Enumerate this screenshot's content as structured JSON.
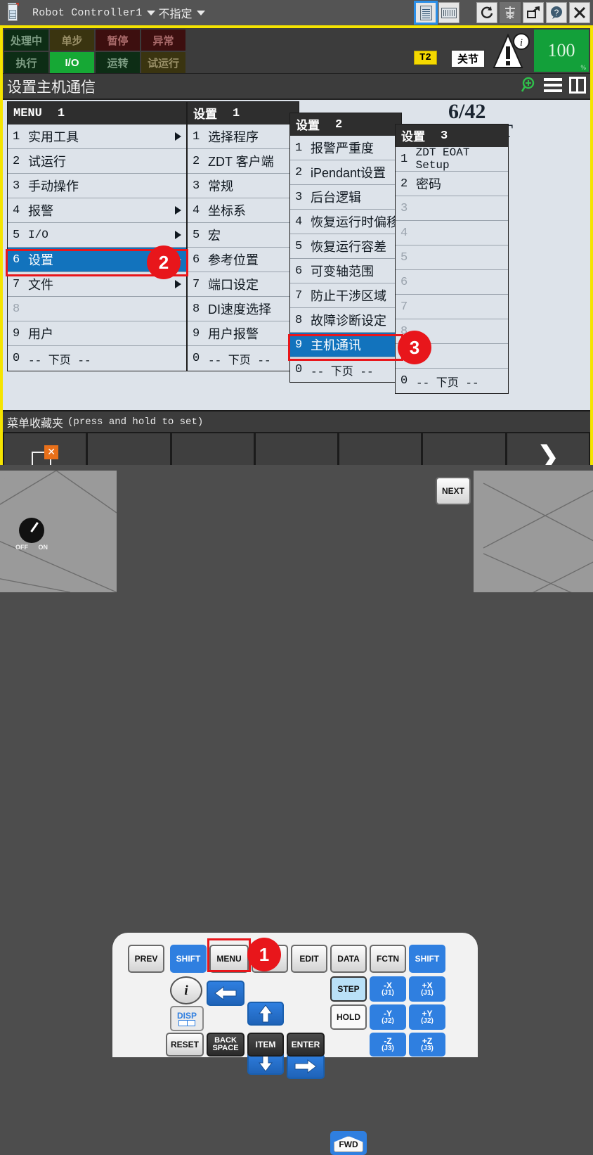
{
  "titlebar": {
    "app_icon": "pendant-icon",
    "title": "Robot Controller1",
    "subtitle": "不指定",
    "buttons": [
      {
        "name": "pendant-view-button",
        "icon": "pendant-icon",
        "selected": true
      },
      {
        "name": "keyboard-button",
        "icon": "keyboard-icon",
        "selected": false
      },
      {
        "name": "refresh-button",
        "icon": "refresh-icon",
        "selected": false
      },
      {
        "name": "robot-tree-button",
        "icon": "robot-tree-icon",
        "selected": false
      },
      {
        "name": "popout-button",
        "icon": "popout-icon",
        "selected": false
      },
      {
        "name": "help-button",
        "icon": "help-icon",
        "selected": false
      },
      {
        "name": "close-button",
        "icon": "close-icon",
        "selected": false
      }
    ]
  },
  "status": {
    "cells": [
      {
        "label": "处理中",
        "style": "dkgreen"
      },
      {
        "label": "单步",
        "style": "olive"
      },
      {
        "label": "暂停",
        "style": "dkred"
      },
      {
        "label": "异常",
        "style": "dkred"
      },
      {
        "label": "执行",
        "style": "dkgreen"
      },
      {
        "label": "I/O",
        "style": "green"
      },
      {
        "label": "运转",
        "style": "dkgreen"
      },
      {
        "label": "试运行",
        "style": "olive"
      }
    ],
    "mode_badge": "T2",
    "coord_badge": "关节",
    "warning_icon": "warning-info-icon",
    "override": "100",
    "override_unit": "%",
    "override_color": "#13a03a"
  },
  "page": {
    "title": "设置主机通信",
    "icons": [
      "zoom-in-icon",
      "menu-list-icon",
      "split-view-icon"
    ],
    "background_count": "6/42",
    "background_label": "ROBOT"
  },
  "menus": [
    {
      "header_title": "MENU",
      "header_num": "1",
      "items": [
        {
          "idx": "1",
          "label": "实用工具",
          "arrow": true
        },
        {
          "idx": "2",
          "label": "试运行",
          "arrow": false
        },
        {
          "idx": "3",
          "label": "手动操作",
          "arrow": false
        },
        {
          "idx": "4",
          "label": "报警",
          "arrow": true
        },
        {
          "idx": "5",
          "label": "I/O",
          "arrow": true,
          "mono": true
        },
        {
          "idx": "6",
          "label": "设置",
          "arrow": true,
          "selected": true
        },
        {
          "idx": "7",
          "label": "文件",
          "arrow": true
        },
        {
          "idx": "8",
          "label": "",
          "arrow": false,
          "dim": true
        },
        {
          "idx": "9",
          "label": "用户",
          "arrow": false
        },
        {
          "idx": "0",
          "label": "-- 下页 --",
          "arrow": false,
          "mono": true
        }
      ]
    },
    {
      "header_title": "设置",
      "header_num": "1",
      "items": [
        {
          "idx": "1",
          "label": "选择程序"
        },
        {
          "idx": "2",
          "label": "ZDT 客户端"
        },
        {
          "idx": "3",
          "label": "常规"
        },
        {
          "idx": "4",
          "label": "坐标系"
        },
        {
          "idx": "5",
          "label": "宏"
        },
        {
          "idx": "6",
          "label": "参考位置"
        },
        {
          "idx": "7",
          "label": "端口设定"
        },
        {
          "idx": "8",
          "label": "DI速度选择"
        },
        {
          "idx": "9",
          "label": "用户报警"
        },
        {
          "idx": "0",
          "label": "-- 下页 --",
          "mono": true
        }
      ]
    },
    {
      "header_title": "设置",
      "header_num": "2",
      "items": [
        {
          "idx": "1",
          "label": "报警严重度"
        },
        {
          "idx": "2",
          "label": "iPendant设置"
        },
        {
          "idx": "3",
          "label": "后台逻辑"
        },
        {
          "idx": "4",
          "label": "恢复运行时偏移"
        },
        {
          "idx": "5",
          "label": "恢复运行容差"
        },
        {
          "idx": "6",
          "label": "可变轴范围"
        },
        {
          "idx": "7",
          "label": "防止干涉区域"
        },
        {
          "idx": "8",
          "label": "故障诊断设定"
        },
        {
          "idx": "9",
          "label": "主机通讯",
          "selected": true
        },
        {
          "idx": "0",
          "label": "-- 下页 --",
          "mono": true
        }
      ]
    },
    {
      "header_title": "设置",
      "header_num": "3",
      "items": [
        {
          "idx": "1",
          "label": "ZDT EOAT Setup",
          "mono": true
        },
        {
          "idx": "2",
          "label": "密码"
        },
        {
          "idx": "3",
          "label": "",
          "dim": true
        },
        {
          "idx": "4",
          "label": "",
          "dim": true
        },
        {
          "idx": "5",
          "label": "",
          "dim": true
        },
        {
          "idx": "6",
          "label": "",
          "dim": true
        },
        {
          "idx": "7",
          "label": "",
          "dim": true
        },
        {
          "idx": "8",
          "label": "",
          "dim": true
        },
        {
          "idx": "9",
          "label": "",
          "dim": true
        },
        {
          "idx": "0",
          "label": "-- 下页 --",
          "mono": true
        }
      ]
    }
  ],
  "callouts": [
    {
      "number": "1",
      "target": "menu-key"
    },
    {
      "number": "2",
      "target": "menu-item-settings"
    },
    {
      "number": "3",
      "target": "menu-item-host-comm"
    }
  ],
  "favorites": {
    "label": "菜单收藏夹",
    "hint": "(press and hold to set)",
    "keys": [
      "close-window-icon",
      "",
      "",
      "",
      "",
      "",
      "next-page-chevron"
    ]
  },
  "keypad": {
    "row1": [
      "PREV",
      "SHIFT",
      "MENU",
      "",
      "EDIT",
      "DATA",
      "FCTN",
      "SHIFT",
      "NEXT"
    ],
    "keys": [
      {
        "label": "PREV",
        "style": "gray"
      },
      {
        "label": "SHIFT",
        "style": "blue"
      },
      {
        "label": "MENU",
        "style": "gray"
      },
      {
        "label": "EDIT",
        "style": "gray"
      },
      {
        "label": "DATA",
        "style": "gray"
      },
      {
        "label": "FCTN",
        "style": "gray"
      },
      {
        "label": "SHIFT",
        "style": "blue"
      },
      {
        "label": "NEXT",
        "style": "gray"
      },
      {
        "label": "STEP",
        "style": "ltblue"
      },
      {
        "label": "HOLD",
        "style": "white"
      },
      {
        "label": "FWD",
        "style": "fwd"
      },
      {
        "label": "RESET",
        "style": "gray"
      },
      {
        "label": "BACK SPACE",
        "style": "dark"
      },
      {
        "label": "ITEM",
        "style": "dark"
      },
      {
        "label": "ENTER",
        "style": "dark"
      },
      {
        "label": "DISP",
        "style": "disp"
      }
    ],
    "jog": [
      {
        "label": "-X",
        "sub": "(J1)"
      },
      {
        "label": "+X",
        "sub": "(J1)"
      },
      {
        "label": "-Y",
        "sub": "(J2)"
      },
      {
        "label": "+Y",
        "sub": "(J2)"
      },
      {
        "label": "-Z",
        "sub": "(J3)"
      },
      {
        "label": "+Z",
        "sub": "(J3)"
      }
    ],
    "knob": {
      "off": "OFF",
      "on": "ON"
    },
    "info_icon": "info-icon"
  }
}
